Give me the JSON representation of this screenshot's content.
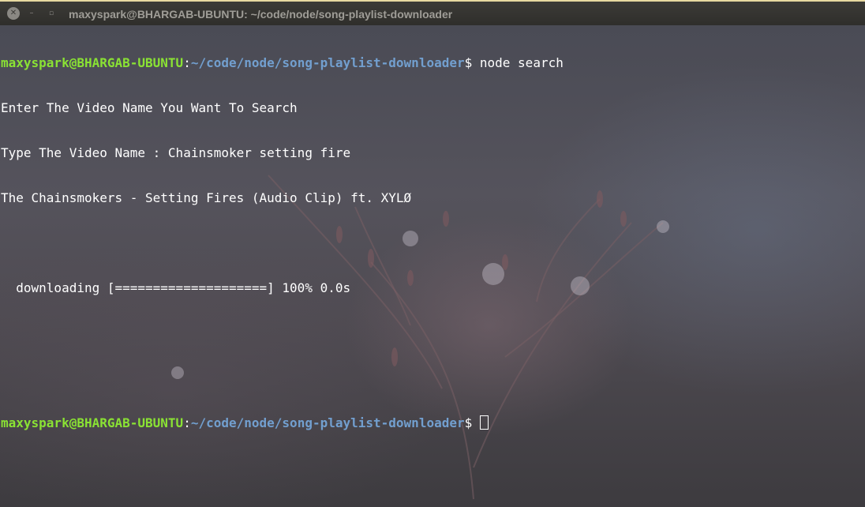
{
  "window": {
    "title": "maxyspark@BHARGAB-UBUNTU: ~/code/node/song-playlist-downloader",
    "close_glyph": "✕",
    "minimize_glyph": "–",
    "maximize_glyph": "▫"
  },
  "terminal": {
    "prompt": {
      "user_host": "maxyspark@BHARGAB-UBUNTU",
      "colon": ":",
      "path": "~/code/node/song-playlist-downloader",
      "symbol": "$"
    },
    "lines": [
      {
        "type": "command",
        "command": " node search"
      },
      {
        "type": "output",
        "text": "Enter The Video Name You Want To Search"
      },
      {
        "type": "output",
        "text": "Type The Video Name : Chainsmoker setting fire"
      },
      {
        "type": "output",
        "text": "The Chainsmokers - Setting Fires (Audio Clip) ft. XYLØ"
      },
      {
        "type": "blank",
        "text": ""
      },
      {
        "type": "output",
        "text": "  downloading [====================] 100% 0.0s"
      },
      {
        "type": "blank",
        "text": ""
      },
      {
        "type": "blank",
        "text": ""
      },
      {
        "type": "prompt",
        "command": " "
      }
    ]
  },
  "colors": {
    "user_host": "#8ae234",
    "path": "#729fcf",
    "text": "#ffffff"
  }
}
